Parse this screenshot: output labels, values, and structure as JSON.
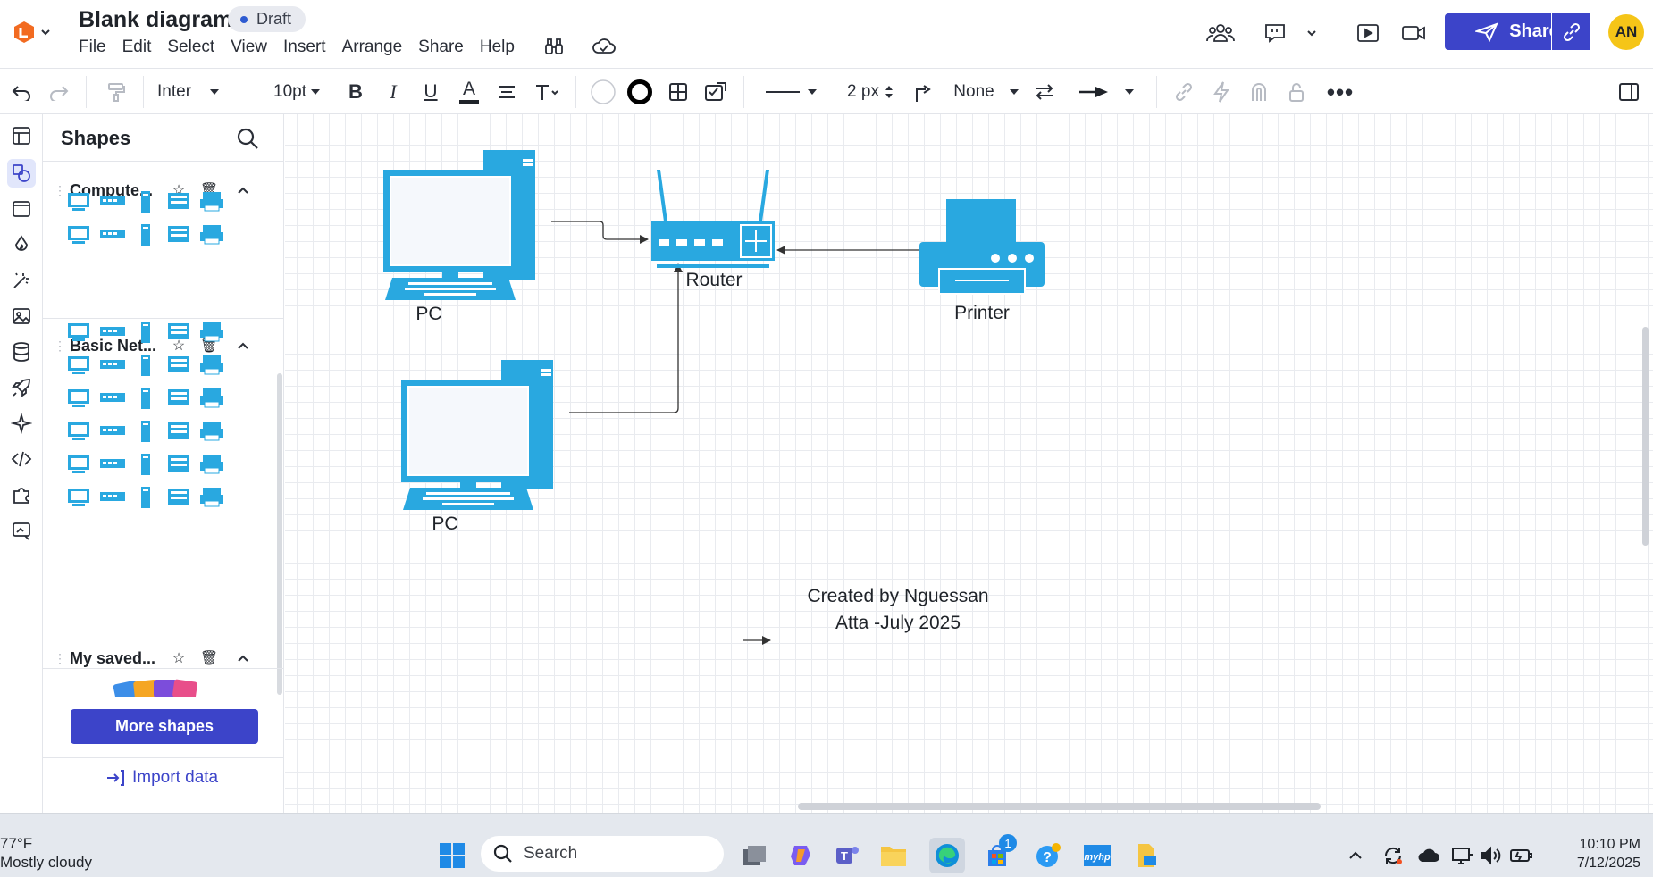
{
  "app": {
    "title": "Blank diagram",
    "status": "Draft",
    "menu": [
      "File",
      "Edit",
      "Select",
      "View",
      "Insert",
      "Arrange",
      "Share",
      "Help"
    ],
    "share_label": "Share",
    "avatar_initials": "AN"
  },
  "toolbar": {
    "font": "Inter",
    "font_size": "10pt",
    "line_width": "2 px",
    "arrow_start": "None"
  },
  "panel": {
    "title": "Shapes",
    "sections": [
      {
        "label": "Compute..."
      },
      {
        "label": "Basic Net..."
      },
      {
        "label": "My saved..."
      }
    ],
    "more_shapes": "More shapes",
    "import_data": "Import data"
  },
  "diagram": {
    "labels": {
      "pc1": "PC",
      "pc2": "PC",
      "router": "Router",
      "printer": "Printer"
    },
    "note_line1": "Created by Nguessan",
    "note_line2": "Atta  -July 2025"
  },
  "taskbar": {
    "temperature": "77°F",
    "weather": "Mostly cloudy",
    "search_placeholder": "Search",
    "time": "10:10 PM",
    "date": "7/12/2025",
    "badge": "1"
  },
  "colors": {
    "accent": "#3c44c9",
    "shape_blue": "#29a8e0",
    "avatar": "#f5c518"
  }
}
